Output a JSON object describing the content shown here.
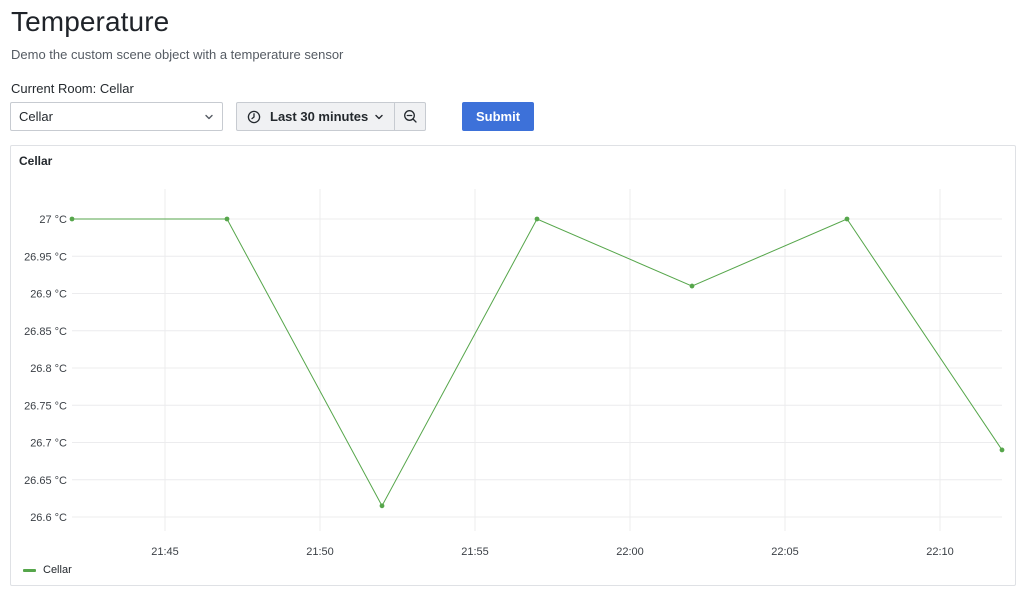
{
  "page": {
    "title": "Temperature",
    "subtitle": "Demo the custom scene object with a temperature sensor",
    "current_room_label": "Current Room: Cellar"
  },
  "controls": {
    "room_select": {
      "value": "Cellar"
    },
    "time_range": {
      "label": "Last 30 minutes"
    },
    "submit_label": "Submit"
  },
  "colors": {
    "accent": "#3d71d9",
    "series": "#56a64b"
  },
  "icons": {
    "time_picker": "clock-icon",
    "dropdown": "chevron-down-icon",
    "zoom": "zoom-out-icon"
  },
  "panel": {
    "title": "Cellar"
  },
  "chart_data": {
    "type": "line",
    "title": "Cellar",
    "x": [
      "21:42",
      "21:47",
      "21:52",
      "21:57",
      "22:02",
      "22:07",
      "22:12"
    ],
    "x_ticks": [
      "21:45",
      "21:50",
      "21:55",
      "22:00",
      "22:05",
      "22:10"
    ],
    "x_range": [
      "21:42",
      "22:12"
    ],
    "series": [
      {
        "name": "Cellar",
        "color": "#56a64b",
        "values": [
          27.0,
          27.0,
          26.615,
          27.0,
          26.91,
          27.0,
          26.69
        ]
      }
    ],
    "y_ticks": [
      {
        "value": 27.0,
        "label": "27 °C"
      },
      {
        "value": 26.95,
        "label": "26.95 °C"
      },
      {
        "value": 26.9,
        "label": "26.9 °C"
      },
      {
        "value": 26.85,
        "label": "26.85 °C"
      },
      {
        "value": 26.8,
        "label": "26.8 °C"
      },
      {
        "value": 26.75,
        "label": "26.75 °C"
      },
      {
        "value": 26.7,
        "label": "26.7 °C"
      },
      {
        "value": 26.65,
        "label": "26.65 °C"
      },
      {
        "value": 26.6,
        "label": "26.6 °C"
      }
    ],
    "ylim": [
      26.6,
      27.0
    ],
    "grid": true,
    "legend": "bottom-left"
  }
}
